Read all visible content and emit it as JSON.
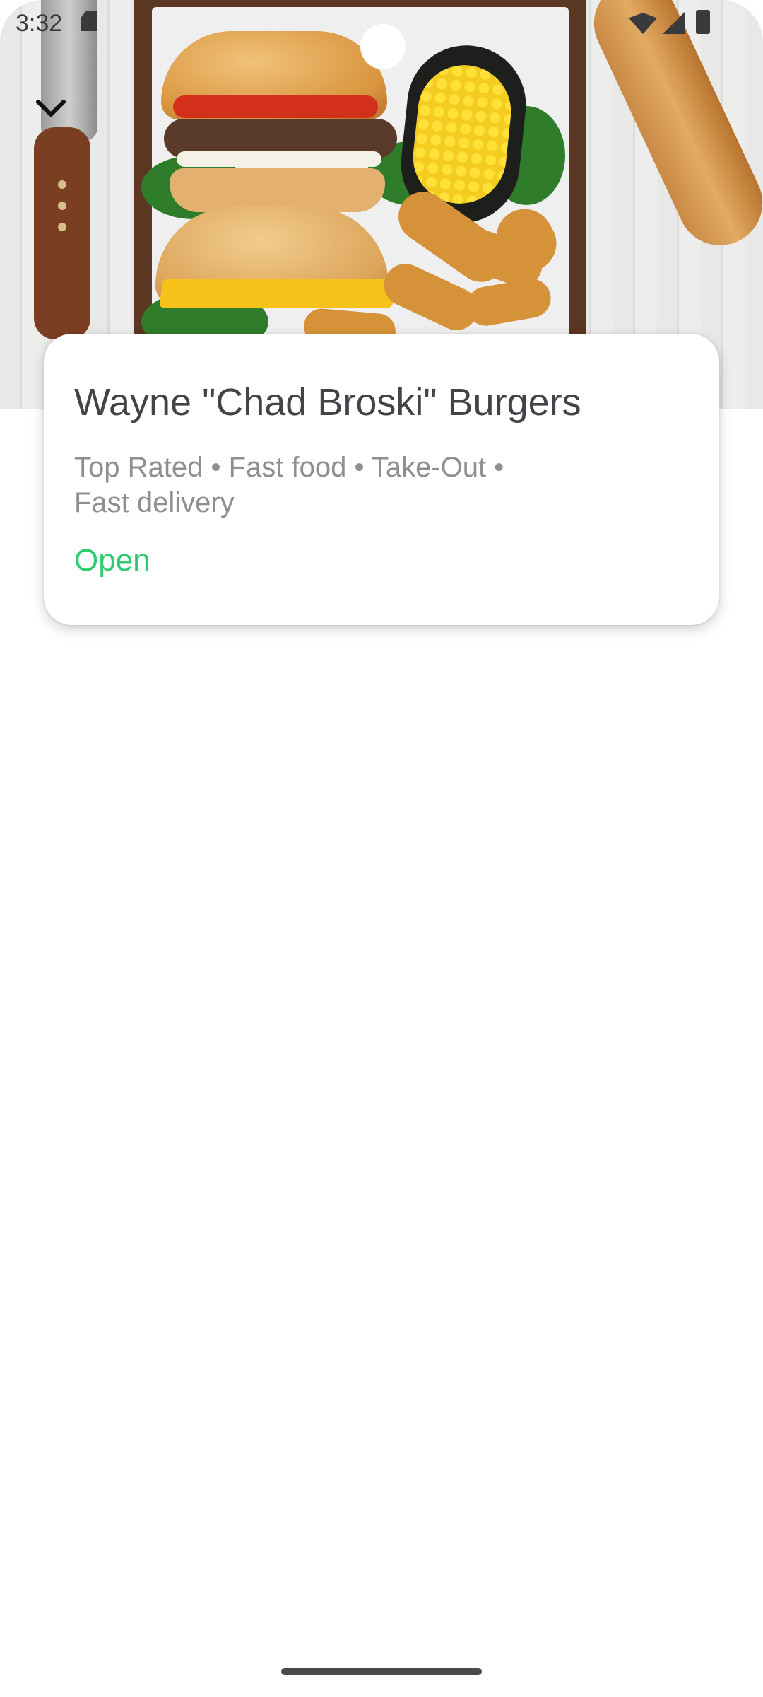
{
  "status_bar": {
    "time": "3:32",
    "icons": [
      "sd-card-icon",
      "wifi-icon",
      "signal-icon",
      "battery-icon"
    ]
  },
  "header": {
    "back_icon": "chevron-down-icon"
  },
  "restaurant": {
    "name": "Wayne \"Chad Broski\" Burgers",
    "tags": "Top Rated • Fast food • Take-Out • Fast delivery",
    "status": "Open"
  },
  "colors": {
    "open_status": "#2ecc71",
    "title_text": "#444349",
    "tags_text": "#8e8e93"
  }
}
